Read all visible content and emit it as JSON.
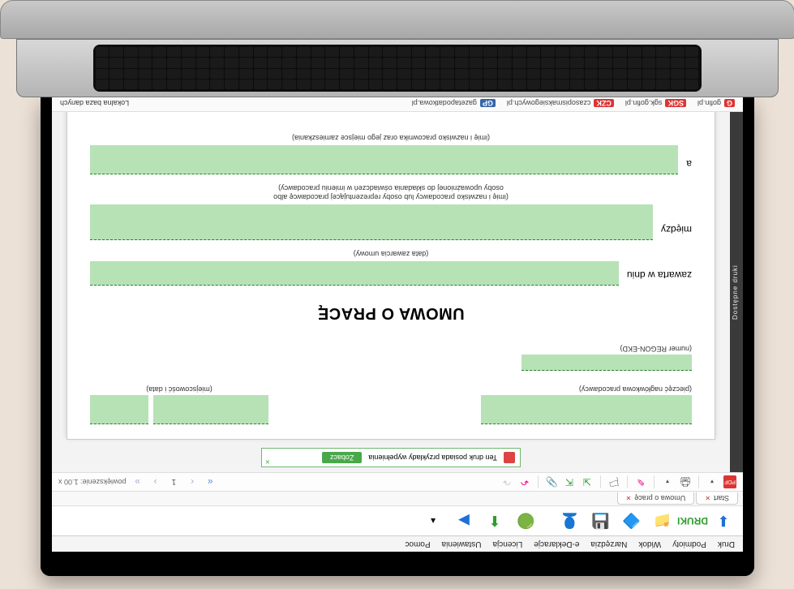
{
  "menu": {
    "items": [
      "Druk",
      "Podmioty",
      "Widok",
      "Narzędzia",
      "e-Deklaracje",
      "Licencja",
      "Ustawienia",
      "Pomoc"
    ]
  },
  "tabs": {
    "start": "Start",
    "doc": "Umowa o pracę"
  },
  "toolbar": {
    "page_num": "1",
    "zoom_label": "powiększenie: 1.00 x"
  },
  "notice": {
    "text": "Ten druk posiada przykłady wypełnienia",
    "button": "Zobacz"
  },
  "side_label": "Dostępne druki",
  "form": {
    "stamp_caption": "(pieczęć nagłówkowa pracodawcy)",
    "loc_caption": "(miejscowość i data)",
    "regon_caption": "(numer REGON-EKD)",
    "title": "UMOWA O PRACĘ",
    "concluded_label": "zawarta w dniu",
    "concluded_caption": "(data zawarcia umowy)",
    "between_label": "między",
    "between_caption1": "(imię i nazwisko pracodawcy lub osoby reprezentującej pracodawcę albo",
    "between_caption2": "osoby upoważnionej do składania oświadczeń w imieniu pracodawcy)",
    "and_label": "a",
    "and_caption": "(imię i nazwisko pracownika oraz jego miejsce zamieszkania)"
  },
  "links": {
    "l1": "gofin.pl",
    "l2": "sgk.gofin.pl",
    "l3": "czasopismaksiegowych.pl",
    "l4": "gazetapodatkowa.pl",
    "db": "Lokalna baza danych"
  }
}
